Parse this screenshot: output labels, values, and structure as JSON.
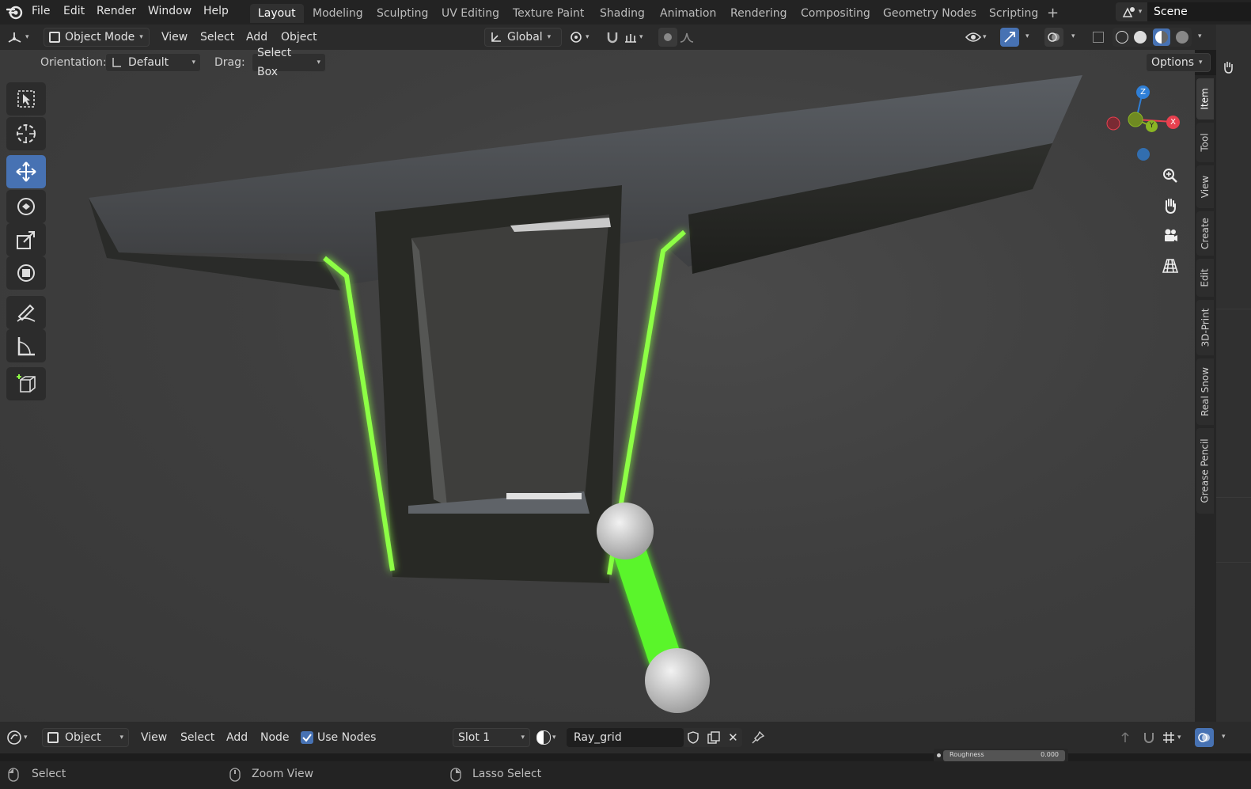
{
  "topbar": {
    "menus": [
      "File",
      "Edit",
      "Render",
      "Window",
      "Help"
    ],
    "workspaces": [
      "Layout",
      "Modeling",
      "Sculpting",
      "UV Editing",
      "Texture Paint",
      "Shading",
      "Animation",
      "Rendering",
      "Compositing",
      "Geometry Nodes",
      "Scripting"
    ],
    "active_workspace": "Layout",
    "add_tab": "+",
    "scene_name": "Scene"
  },
  "viewport_header": {
    "mode": "Object Mode",
    "menus": [
      "View",
      "Select",
      "Add",
      "Object"
    ],
    "transform_orientation": "Global"
  },
  "tool_header": {
    "orientation_label": "Orientation:",
    "orientation_value": "Default",
    "drag_label": "Drag:",
    "drag_value": "Select Box",
    "options_label": "Options"
  },
  "sidebar_tabs": [
    "Item",
    "Tool",
    "View",
    "Create",
    "Edit",
    "3D-Print",
    "Real Snow",
    "Grease Pencil"
  ],
  "active_sidebar_tab": "Item",
  "gizmo": {
    "x": "X",
    "y": "Y",
    "z": "Z"
  },
  "node_header": {
    "editor_mode": "Object",
    "menus": [
      "View",
      "Select",
      "Add",
      "Node"
    ],
    "use_nodes_label": "Use Nodes",
    "use_nodes_checked": true,
    "slot": "Slot 1",
    "material_name": "Ray_grid",
    "roughness_label": "Roughness",
    "roughness_value": "0.000"
  },
  "statusbar": {
    "items": [
      "Select",
      "Zoom View",
      "Lasso Select"
    ]
  },
  "colors": {
    "accent": "#4772b3",
    "glow": "#7dff3c",
    "axis_x": "#e8404f",
    "axis_y": "#8ab524",
    "axis_z": "#2f7fd6"
  }
}
